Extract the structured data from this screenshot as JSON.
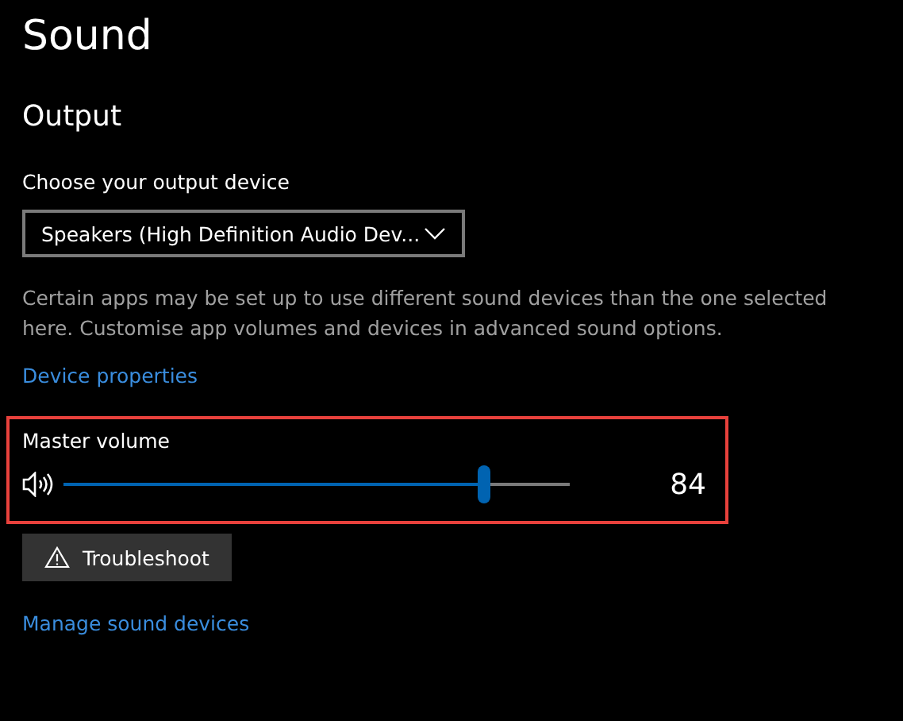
{
  "title": "Sound",
  "section": "Output",
  "device_label": "Choose your output device",
  "device_select": {
    "value": "Speakers (High Definition Audio Dev..."
  },
  "description": "Certain apps may be set up to use different sound devices than the one selected here. Customise app volumes and devices in advanced sound options.",
  "device_properties_link": "Device properties",
  "master_volume": {
    "label": "Master volume",
    "level": 0.83,
    "reading": "84",
    "highlighted": true
  },
  "troubleshoot_button": "Troubleshoot",
  "manage_link": "Manage sound devices"
}
